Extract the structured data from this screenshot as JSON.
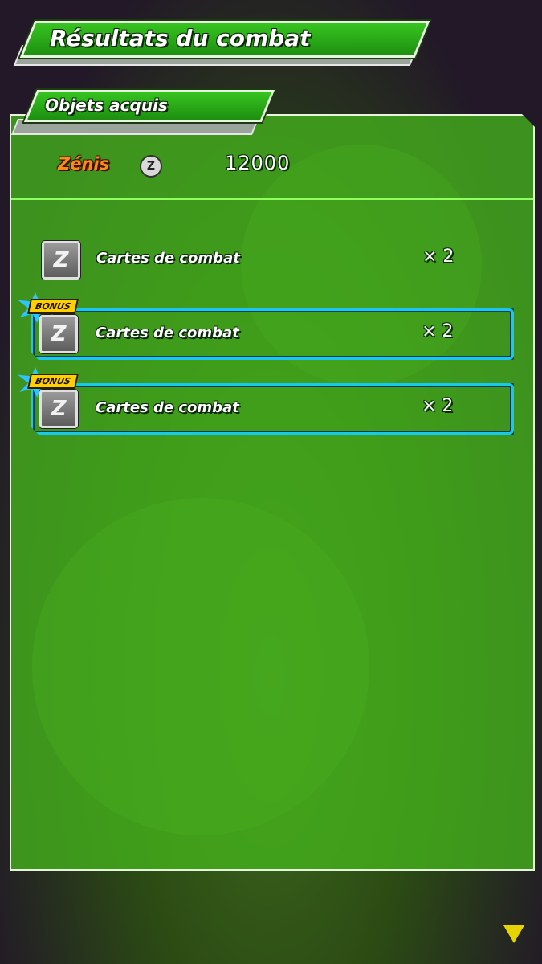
{
  "header": {
    "title": "Résultats du combat"
  },
  "section": {
    "title": "Objets acquis"
  },
  "zenis": {
    "label": "Zénis",
    "icon": "zeni-coin-icon",
    "coin_symbol": "Z",
    "value": "12000"
  },
  "items": [
    {
      "label": "Cartes de combat",
      "quantity": "× 2",
      "icon": "z-card-icon",
      "icon_symbol": "Z",
      "bonus": false
    },
    {
      "label": "Cartes de combat",
      "quantity": "× 2",
      "icon": "z-card-icon",
      "icon_symbol": "Z",
      "bonus": true,
      "bonus_label": "BONUS"
    },
    {
      "label": "Cartes de combat",
      "quantity": "× 2",
      "icon": "z-card-icon",
      "icon_symbol": "Z",
      "bonus": true,
      "bonus_label": "BONUS"
    }
  ],
  "colors": {
    "panel": "#45b41c",
    "bonus_frame": "#17c9f0",
    "zenis_label": "#ff8a1c",
    "next_arrow": "#e6d300"
  }
}
